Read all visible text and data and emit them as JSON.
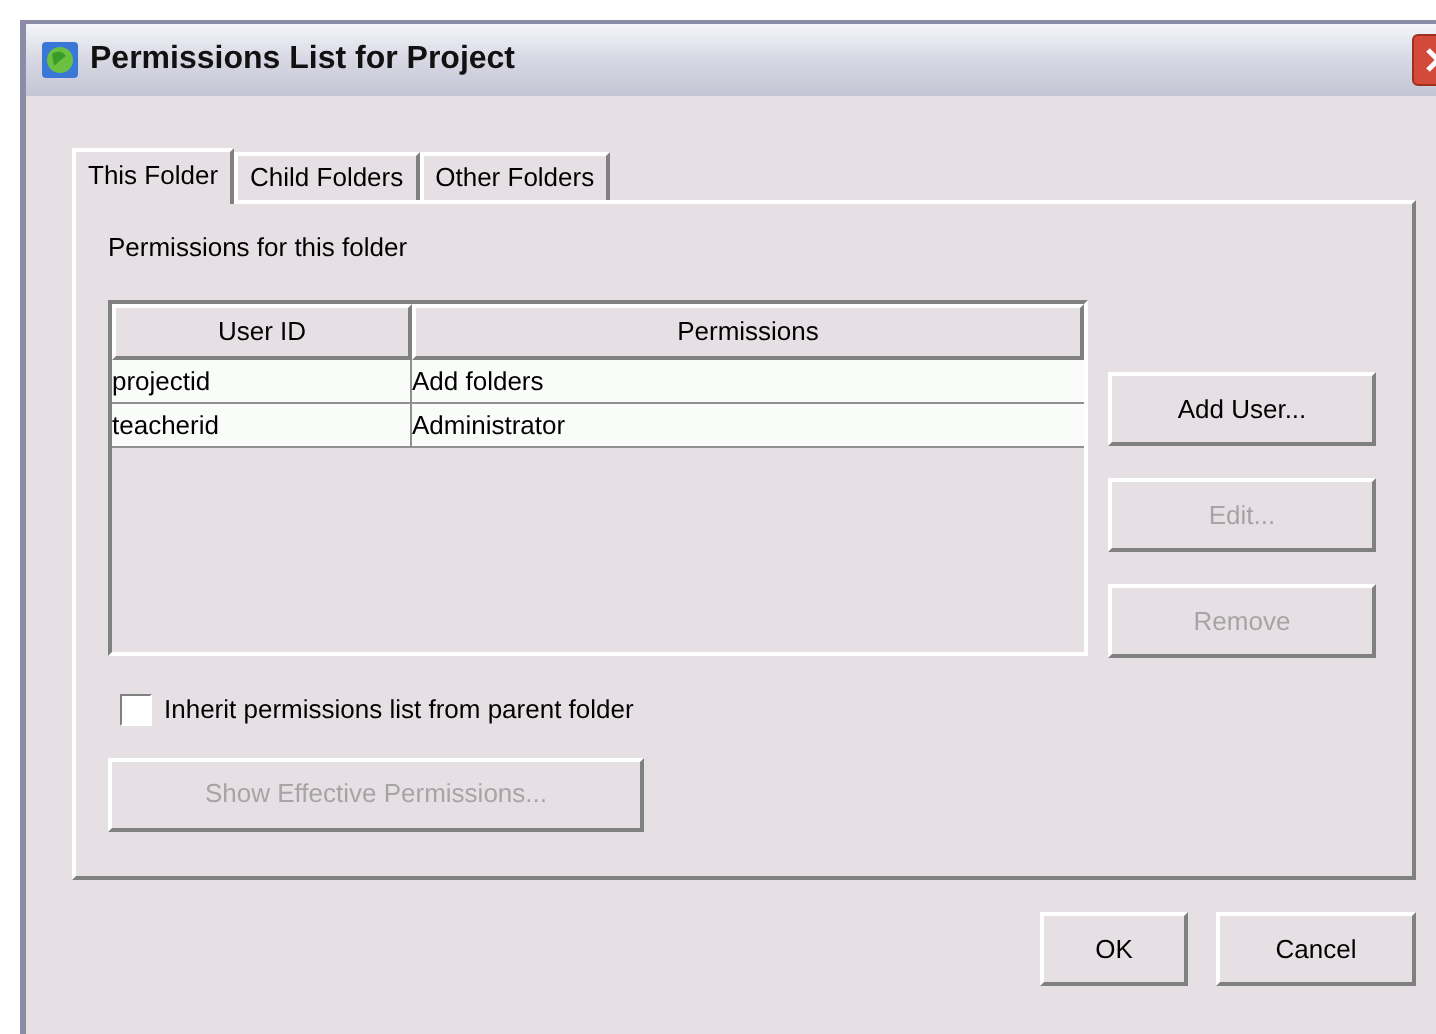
{
  "window": {
    "title": "Permissions List for Project"
  },
  "tabs": [
    {
      "label": "This Folder",
      "selected": true
    },
    {
      "label": "Child Folders",
      "selected": false
    },
    {
      "label": "Other Folders",
      "selected": false
    }
  ],
  "section_label": "Permissions for this folder",
  "table": {
    "columns": [
      "User ID",
      "Permissions"
    ],
    "rows": [
      [
        "projectid",
        "Add folders"
      ],
      [
        "teacherid",
        "Administrator"
      ]
    ]
  },
  "side_buttons": [
    {
      "label": "Add User...",
      "disabled": false
    },
    {
      "label": "Edit...",
      "disabled": true
    },
    {
      "label": "Remove",
      "disabled": true
    }
  ],
  "inherit": {
    "label": "Inherit permissions list from parent folder",
    "checked": false
  },
  "effective_button": {
    "label": "Show Effective Permissions...",
    "disabled": true
  },
  "buttons": [
    "OK",
    "Cancel"
  ]
}
